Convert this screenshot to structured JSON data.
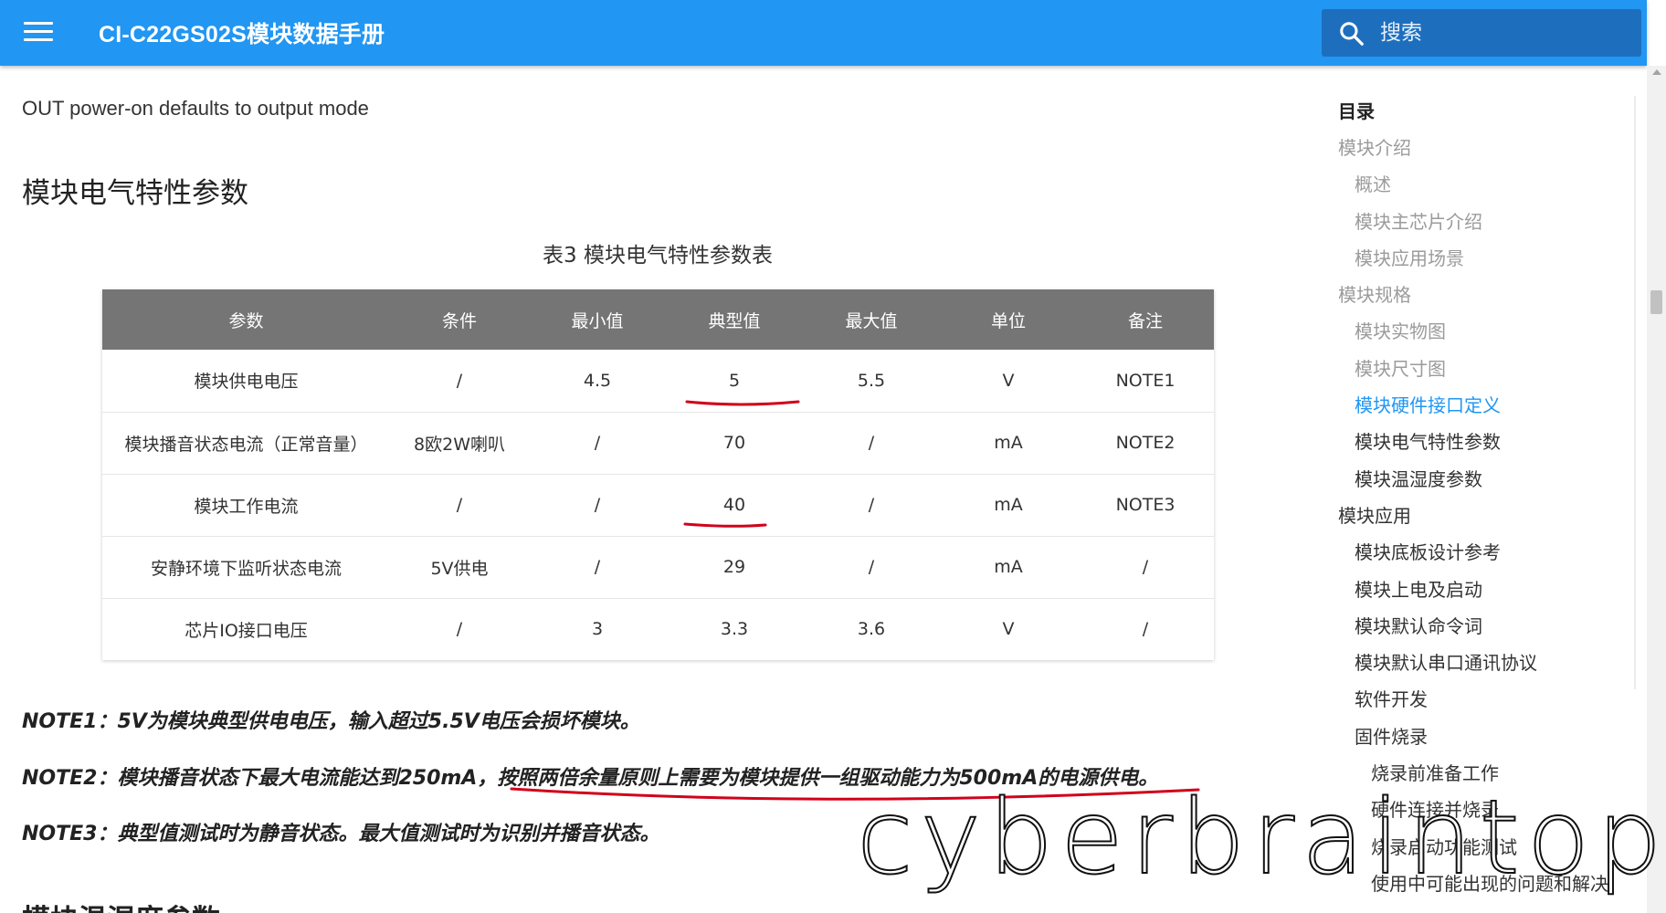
{
  "header": {
    "title": "CI-C22GS02S模块数据手册",
    "search_placeholder": "搜索",
    "color": "#2196f3"
  },
  "content": {
    "intro": "OUT power-on defaults to output mode",
    "section_title": "模块电气特性参数",
    "table_caption": "表3 模块电气特性参数表",
    "table": {
      "headers": [
        "参数",
        "条件",
        "最小值",
        "典型值",
        "最大值",
        "单位",
        "备注"
      ],
      "rows": [
        [
          "模块供电电压",
          "/",
          "4.5",
          "5",
          "5.5",
          "V",
          "NOTE1"
        ],
        [
          "模块播音状态电流（正常音量）",
          "8欧2W喇叭",
          "/",
          "70",
          "/",
          "mA",
          "NOTE2"
        ],
        [
          "模块工作电流",
          "/",
          "/",
          "40",
          "/",
          "mA",
          "NOTE3"
        ],
        [
          "安静环境下监听状态电流",
          "5V供电",
          "/",
          "29",
          "/",
          "mA",
          "/"
        ],
        [
          "芯片IO接口电压",
          "/",
          "3",
          "3.3",
          "3.6",
          "V",
          "/"
        ]
      ]
    },
    "notes": {
      "note1": "NOTE1：5V为模块典型供电电压，输入超过5.5V电压会损坏模块。",
      "note2_a": "NOTE2：模块播音状态下最大电流能达到250mA，",
      "note2_b": "按照两倍余量原则上需要为模块提供一组驱动能力为500mA的电源供电。",
      "note3": "NOTE3：典型值测试时为静音状态。最大值测试时为识别并播音状态。"
    },
    "next_heading": "模块温湿度参数"
  },
  "toc": {
    "title": "目录",
    "items": [
      {
        "label": "模块介绍",
        "level": 1,
        "state": "dim"
      },
      {
        "label": "概述",
        "level": 2,
        "state": "dim"
      },
      {
        "label": "模块主芯片介绍",
        "level": 2,
        "state": "dim"
      },
      {
        "label": "模块应用场景",
        "level": 2,
        "state": "dim"
      },
      {
        "label": "模块规格",
        "level": 1,
        "state": "dim"
      },
      {
        "label": "模块实物图",
        "level": 2,
        "state": "dim"
      },
      {
        "label": "模块尺寸图",
        "level": 2,
        "state": "dim"
      },
      {
        "label": "模块硬件接口定义",
        "level": 2,
        "state": "active"
      },
      {
        "label": "模块电气特性参数",
        "level": 2,
        "state": "normal"
      },
      {
        "label": "模块温湿度参数",
        "level": 2,
        "state": "normal"
      },
      {
        "label": "模块应用",
        "level": 1,
        "state": "normal"
      },
      {
        "label": "模块底板设计参考",
        "level": 2,
        "state": "normal"
      },
      {
        "label": "模块上电及启动",
        "level": 2,
        "state": "normal"
      },
      {
        "label": "模块默认命令词",
        "level": 2,
        "state": "normal"
      },
      {
        "label": "模块默认串口通讯协议",
        "level": 2,
        "state": "normal"
      },
      {
        "label": "软件开发",
        "level": 2,
        "state": "normal"
      },
      {
        "label": "固件烧录",
        "level": 2,
        "state": "normal"
      },
      {
        "label": "烧录前准备工作",
        "level": 3,
        "state": "normal"
      },
      {
        "label": "硬件连接并烧录",
        "level": 3,
        "state": "normal"
      },
      {
        "label": "烧录启动功能测试",
        "level": 3,
        "state": "normal"
      },
      {
        "label": "使用中可能出现的问题和解决",
        "level": 3,
        "state": "normal"
      }
    ]
  },
  "watermark": "cyberbraintop",
  "annotation_color": "#d0021b"
}
